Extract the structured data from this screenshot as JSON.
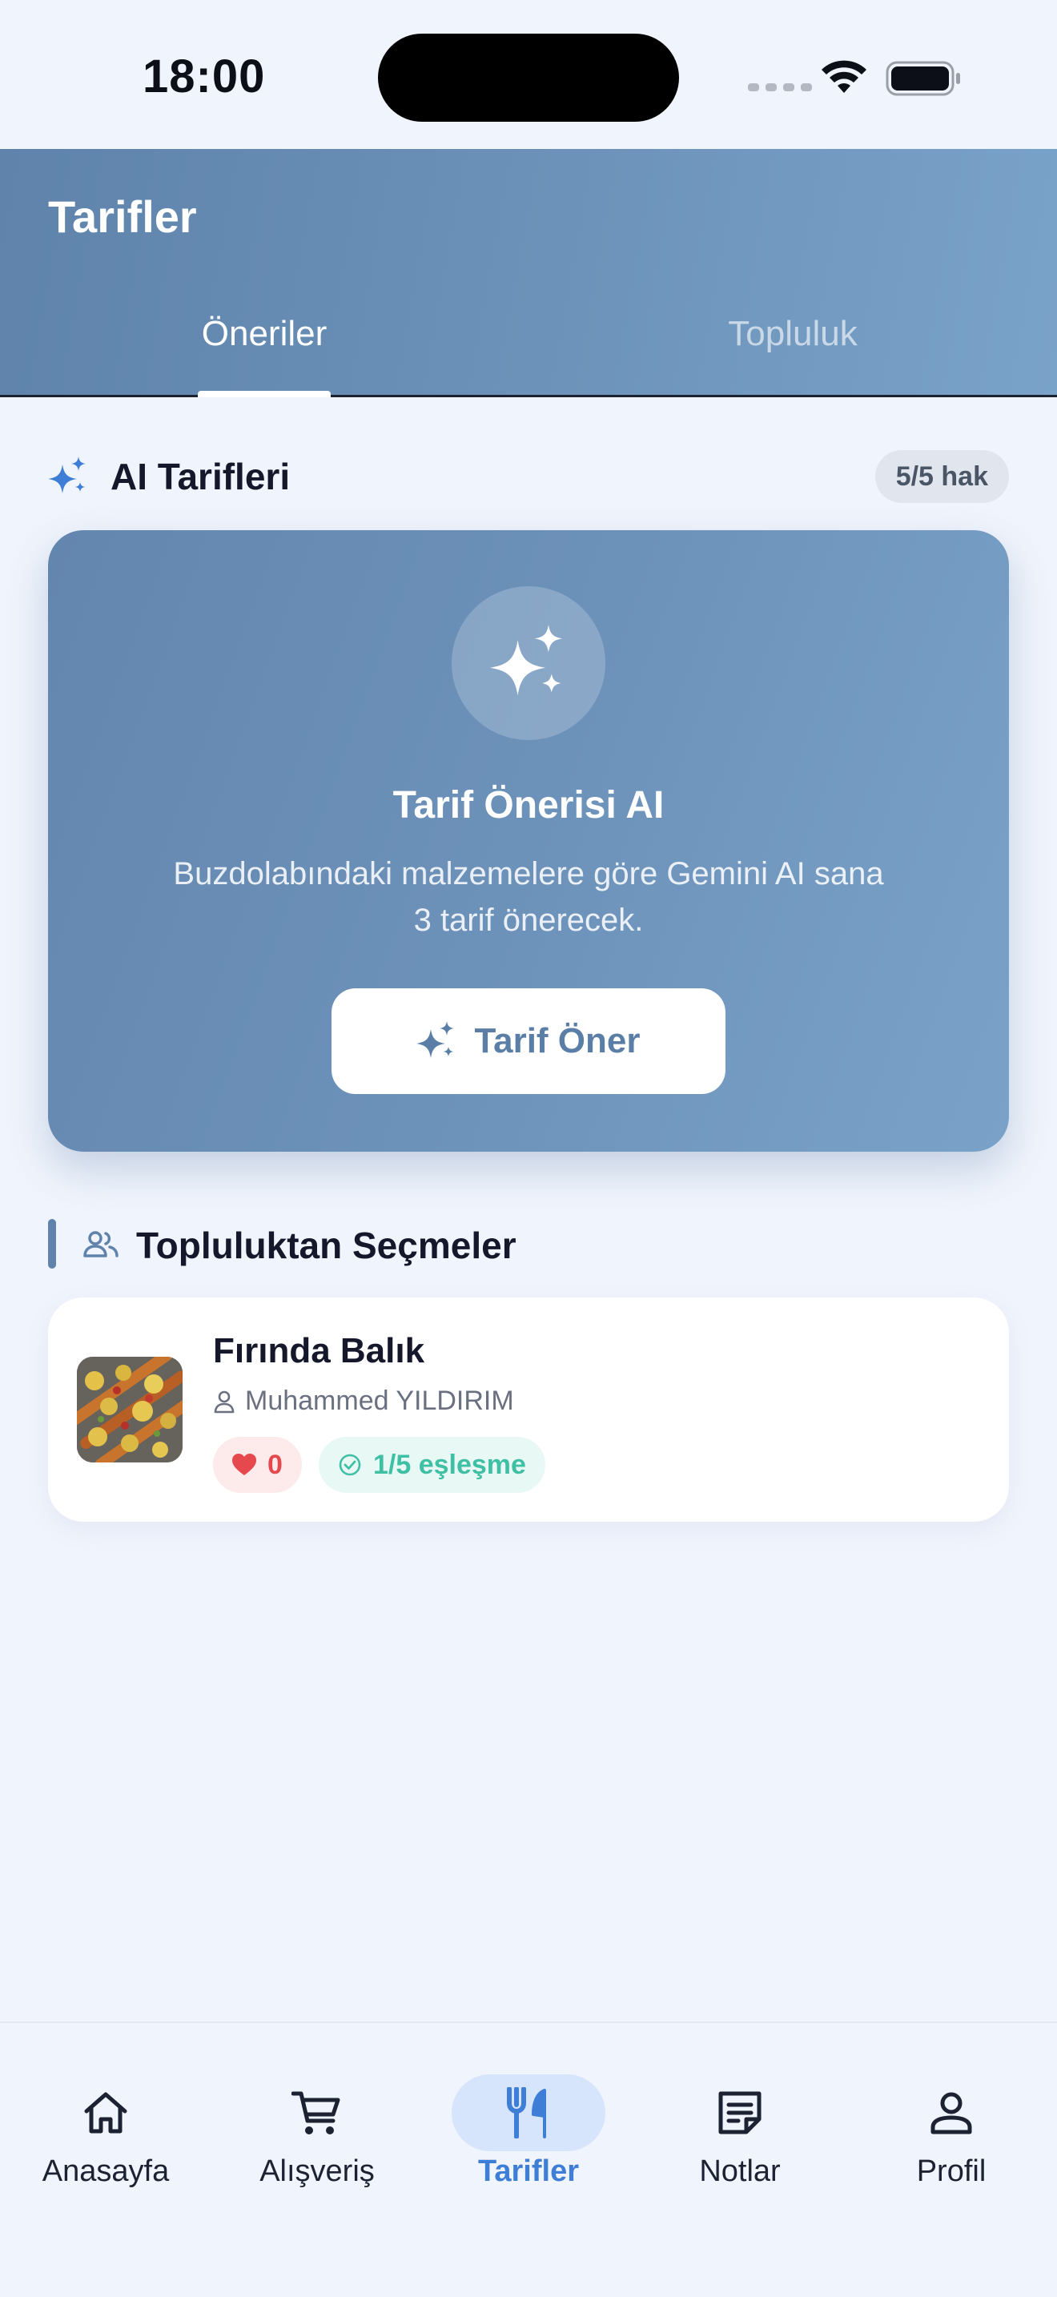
{
  "status_bar": {
    "time": "18:00"
  },
  "header": {
    "title": "Tarifler",
    "tabs": [
      {
        "label": "Öneriler",
        "active": true
      },
      {
        "label": "Topluluk",
        "active": false
      }
    ]
  },
  "ai_section": {
    "title": "AI Tarifleri",
    "quota": "5/5 hak",
    "card": {
      "title": "Tarif Önerisi AI",
      "description": "Buzdolabındaki malzemelere göre Gemini AI sana 3 tarif önerecek.",
      "button_label": "Tarif Öner",
      "icon": "sparkles-icon"
    }
  },
  "community_section": {
    "title": "Topluluktan Seçmeler",
    "recipes": [
      {
        "name": "Fırında Balık",
        "author": "Muhammed YILDIRIM",
        "likes": "0",
        "match": "1/5 eşleşme"
      }
    ]
  },
  "bottom_nav": {
    "items": [
      {
        "label": "Anasayfa",
        "icon": "home-icon",
        "active": false
      },
      {
        "label": "Alışveriş",
        "icon": "cart-icon",
        "active": false
      },
      {
        "label": "Tarifler",
        "icon": "utensils-icon",
        "active": true
      },
      {
        "label": "Notlar",
        "icon": "notes-icon",
        "active": false
      },
      {
        "label": "Profil",
        "icon": "profile-icon",
        "active": false
      }
    ]
  },
  "colors": {
    "accent": "#5f83ab",
    "active_nav": "#3f7ed6",
    "like": "#e5484d",
    "match": "#3fbfa4",
    "background": "#f0f4fc"
  }
}
